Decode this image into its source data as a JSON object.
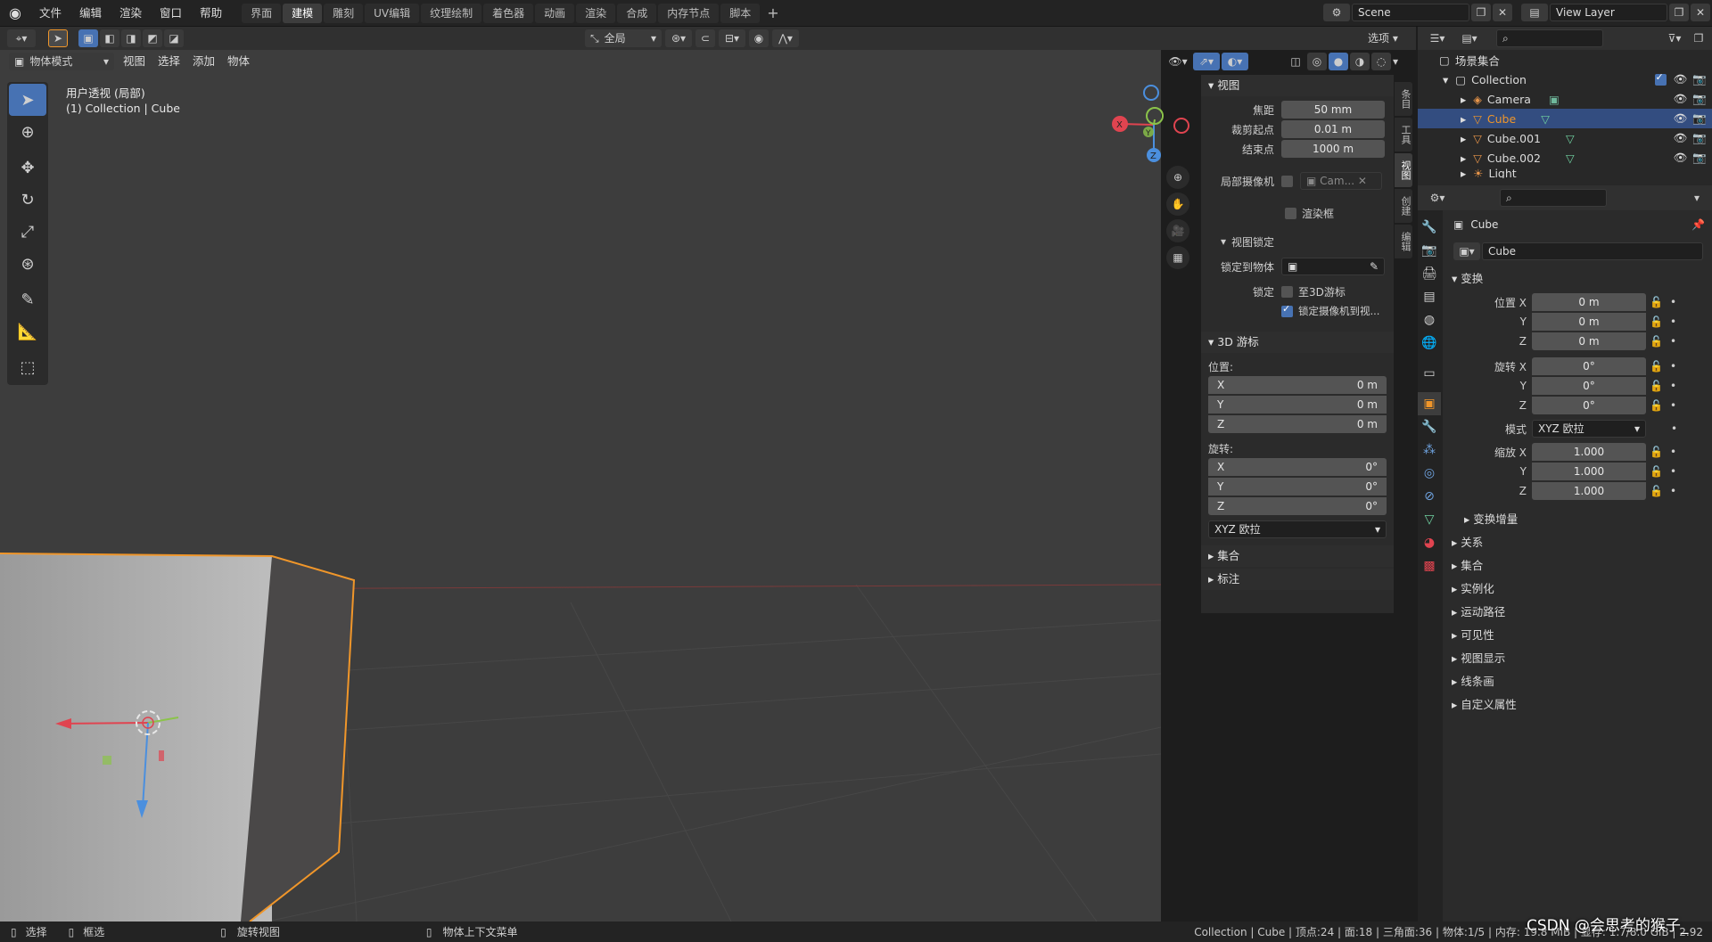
{
  "topbar": {
    "menus": [
      "文件",
      "编辑",
      "渲染",
      "窗口",
      "帮助"
    ],
    "workspaces": [
      "界面",
      "建模",
      "雕刻",
      "UV编辑",
      "纹理绘制",
      "着色器",
      "动画",
      "渲染",
      "合成",
      "内存节点",
      "脚本"
    ],
    "active_workspace": "建模",
    "add_tab": "+",
    "scene": "Scene",
    "view_layer": "View Layer"
  },
  "viewport_header": {
    "transform_orient": "全局",
    "options": "选项",
    "mode": "物体模式",
    "menus": [
      "视图",
      "选择",
      "添加",
      "物体"
    ]
  },
  "viewport": {
    "view_name": "用户透视 (局部)",
    "collection_info": "(1) Collection | Cube",
    "gizmo": {
      "x": "X",
      "y": "Y",
      "z": "Z"
    }
  },
  "npanel": {
    "view_section": "视图",
    "focal_label": "焦距",
    "focal_value": "50 mm",
    "clip_start_label": "裁剪起点",
    "clip_start_value": "0.01 m",
    "clip_end_label": "结束点",
    "clip_end_value": "1000 m",
    "local_camera_label": "局部摄像机",
    "local_camera_value": "Cam...",
    "render_region_label": "渲染框",
    "view_lock_section": "视图锁定",
    "lock_to_object_label": "锁定到物体",
    "lock_label": "锁定",
    "lock_cursor_label": "至3D游标",
    "lock_camera_label": "锁定摄像机到视...",
    "cursor_section": "3D 游标",
    "location_label": "位置:",
    "loc_x_label": "X",
    "loc_x_value": "0 m",
    "loc_y_label": "Y",
    "loc_y_value": "0 m",
    "loc_z_label": "Z",
    "loc_z_value": "0 m",
    "rotation_label": "旋转:",
    "rot_x_label": "X",
    "rot_x_value": "0°",
    "rot_y_label": "Y",
    "rot_y_value": "0°",
    "rot_z_label": "Z",
    "rot_z_value": "0°",
    "rot_mode": "XYZ 欧拉",
    "collection_section": "集合",
    "annotation_section": "标注",
    "side_tabs": [
      "条目",
      "工具",
      "视图",
      "创建",
      "编辑"
    ],
    "active_side_tab": "视图"
  },
  "outliner": {
    "scene_collection": "场景集合",
    "collection": "Collection",
    "items": [
      "Camera",
      "Cube",
      "Cube.001",
      "Cube.002",
      "Light"
    ],
    "selected": "Cube"
  },
  "properties": {
    "object_name": "Cube",
    "object_field": "Cube",
    "transform_section": "变换",
    "location_x_label": "位置 X",
    "location_x": "0 m",
    "location_y_label": "Y",
    "location_y": "0 m",
    "location_z_label": "Z",
    "location_z": "0 m",
    "rotation_x_label": "旋转 X",
    "rotation_x": "0°",
    "rotation_y_label": "Y",
    "rotation_y": "0°",
    "rotation_z_label": "Z",
    "rotation_z": "0°",
    "mode_label": "模式",
    "mode_value": "XYZ 欧拉",
    "scale_x_label": "缩放 X",
    "scale_x": "1.000",
    "scale_y_label": "Y",
    "scale_y": "1.000",
    "scale_z_label": "Z",
    "scale_z": "1.000",
    "delta_transform": "变换增量",
    "sections": [
      "关系",
      "集合",
      "实例化",
      "运动路径",
      "可见性",
      "视图显示",
      "线条画",
      "自定义属性"
    ]
  },
  "statusbar": {
    "select": "选择",
    "box_select": "框选",
    "rotate_view": "旋转视图",
    "context_menu": "物体上下文菜单",
    "stats": "Collection | Cube | 顶点:24 | 面:18 | 三角面:36 | 物体:1/5 | 内存: 19.8 MiB | 显存: 1.7/8.0 GiB | 2.92",
    "watermark": "CSDN @会思考的猴子_"
  },
  "colors": {
    "accent": "#4772b3",
    "selection_outline": "#f0962a",
    "axis_x": "#e04450",
    "axis_y": "#8bc34a",
    "axis_z": "#4b8fde"
  }
}
